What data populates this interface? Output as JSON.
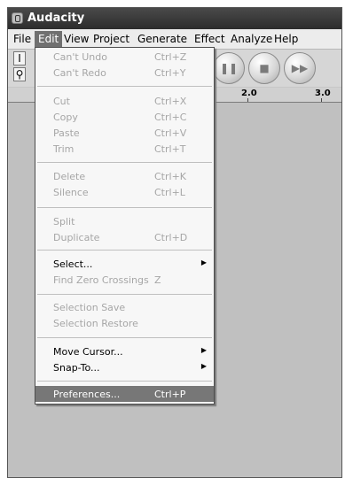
{
  "window": {
    "title": "Audacity"
  },
  "menubar": {
    "items": [
      {
        "label": "File"
      },
      {
        "label": "Edit"
      },
      {
        "label": "View"
      },
      {
        "label": "Project"
      },
      {
        "label": "Generate"
      },
      {
        "label": "Effect"
      },
      {
        "label": "Analyze"
      },
      {
        "label": "Help"
      }
    ]
  },
  "toolbar": {
    "tools": [
      "I",
      "⚲"
    ],
    "buttons": [
      {
        "name": "pause",
        "glyph": "❚❚"
      },
      {
        "name": "stop",
        "glyph": "■"
      },
      {
        "name": "skip-end",
        "glyph": "▶▶"
      }
    ]
  },
  "ruler": {
    "ticks": [
      "2.0",
      "3.0"
    ]
  },
  "edit_menu": {
    "items": [
      {
        "label": "Can't Undo",
        "shortcut": "Ctrl+Z",
        "enabled": false
      },
      {
        "label": "Can't Redo",
        "shortcut": "Ctrl+Y",
        "enabled": false
      },
      {
        "label": "Cut",
        "shortcut": "Ctrl+X",
        "enabled": false
      },
      {
        "label": "Copy",
        "shortcut": "Ctrl+C",
        "enabled": false
      },
      {
        "label": "Paste",
        "shortcut": "Ctrl+V",
        "enabled": false
      },
      {
        "label": "Trim",
        "shortcut": "Ctrl+T",
        "enabled": false
      },
      {
        "label": "Delete",
        "shortcut": "Ctrl+K",
        "enabled": false
      },
      {
        "label": "Silence",
        "shortcut": "Ctrl+L",
        "enabled": false
      },
      {
        "label": "Split",
        "shortcut": "",
        "enabled": false
      },
      {
        "label": "Duplicate",
        "shortcut": "Ctrl+D",
        "enabled": false
      },
      {
        "label": "Select...",
        "shortcut": "",
        "enabled": true,
        "submenu": true
      },
      {
        "label": "Find Zero Crossings",
        "shortcut": "Z",
        "enabled": false
      },
      {
        "label": "Selection Save",
        "shortcut": "",
        "enabled": false
      },
      {
        "label": "Selection Restore",
        "shortcut": "",
        "enabled": false
      },
      {
        "label": "Move Cursor...",
        "shortcut": "",
        "enabled": true,
        "submenu": true
      },
      {
        "label": "Snap-To...",
        "shortcut": "",
        "enabled": true,
        "submenu": true
      },
      {
        "label": "Preferences...",
        "shortcut": "Ctrl+P",
        "enabled": true,
        "highlighted": true
      }
    ]
  }
}
